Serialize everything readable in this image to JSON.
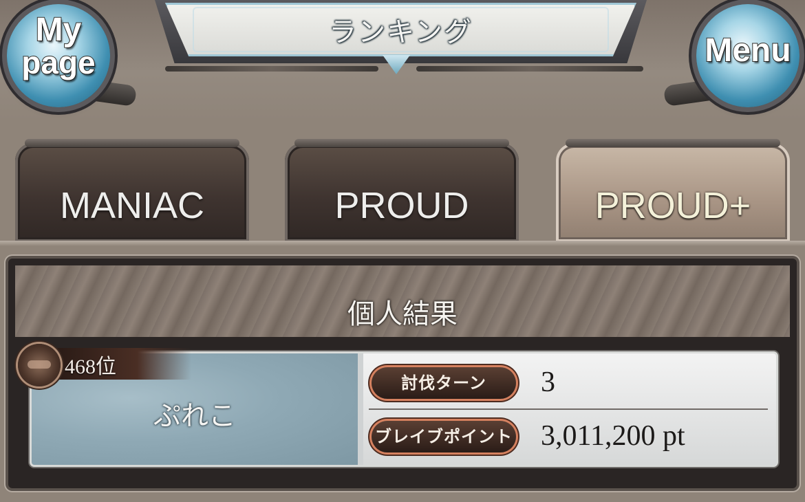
{
  "header": {
    "title": "ランキング",
    "mypage_button": {
      "line1": "My",
      "line2": "page"
    },
    "menu_button": {
      "label": "Menu"
    }
  },
  "tabs": [
    {
      "label": "MANIAC",
      "active": false
    },
    {
      "label": "PROUD",
      "active": false
    },
    {
      "label": "PROUD+",
      "active": true
    }
  ],
  "results": {
    "heading": "個人結果",
    "entry": {
      "rank": "468位",
      "player_name": "ぷれこ",
      "stats": [
        {
          "label": "討伐ターン",
          "value": "3"
        },
        {
          "label": "ブレイブポイント",
          "value": "3,011,200 pt"
        }
      ]
    }
  }
}
